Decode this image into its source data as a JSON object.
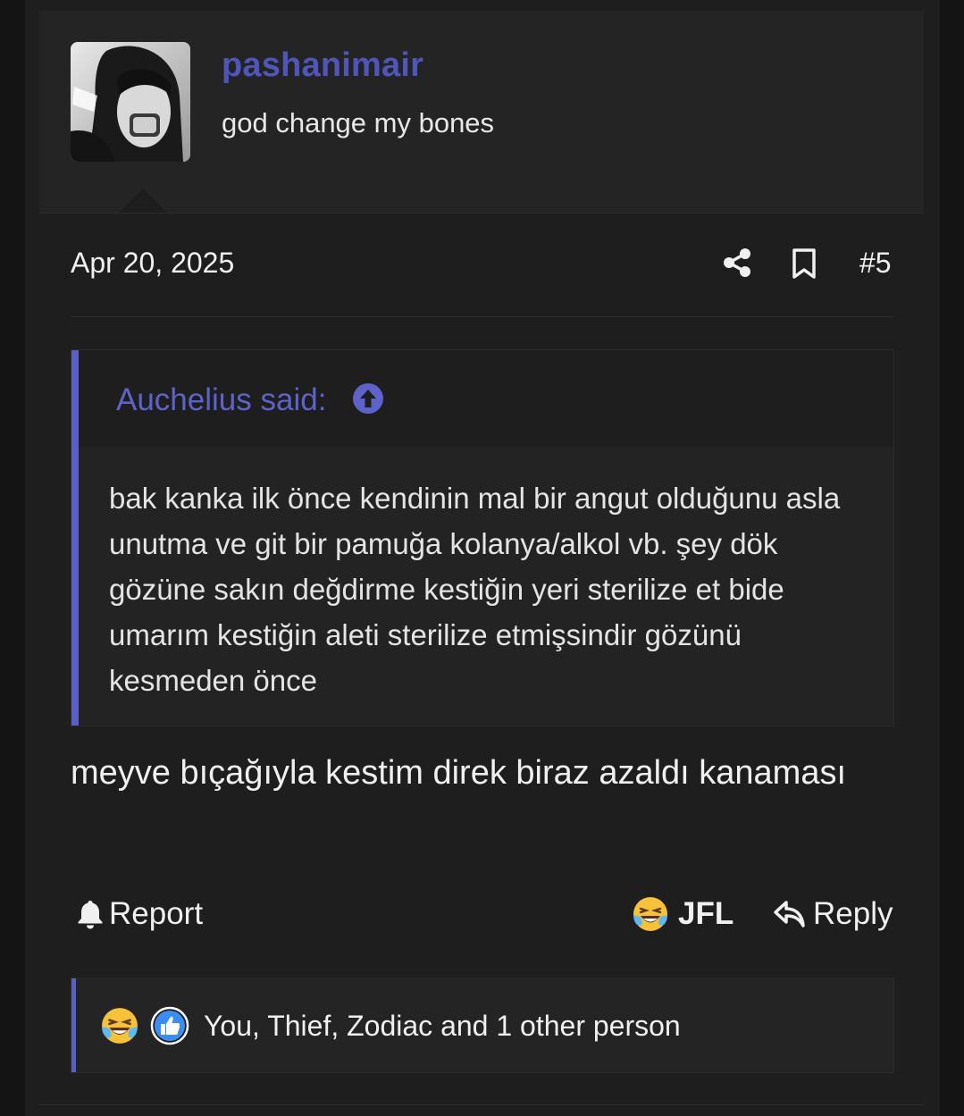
{
  "post": {
    "username": "pashanimair",
    "user_title": "god change my bones",
    "date": "Apr 20, 2025",
    "post_number": "#5",
    "quote": {
      "author_label": "Auchelius said:",
      "text": "bak kanka ilk önce kendinin mal bir angut olduğunu asla unutma ve git bir pamuğa kolanya/alkol vb. şey dök gözüne sakın değdirme kestiğin yeri sterilize et bide umarım kestiğin aleti sterilize etmişsindir gözünü kesmeden önce"
    },
    "message": "meyve bıçağıyla kestim direk biraz azaldı kanaması"
  },
  "actions": {
    "report_label": "Report",
    "jfl_label": "JFL",
    "reply_label": "Reply"
  },
  "reactions": {
    "summary": "You, Thief, Zodiac and 1 other person",
    "icons": [
      "laughing-crying-emoji",
      "thumbs-up-emoji"
    ]
  },
  "colors": {
    "accent": "#5a5fc4",
    "username": "#4f55b9",
    "background": "#1e1e1e"
  }
}
